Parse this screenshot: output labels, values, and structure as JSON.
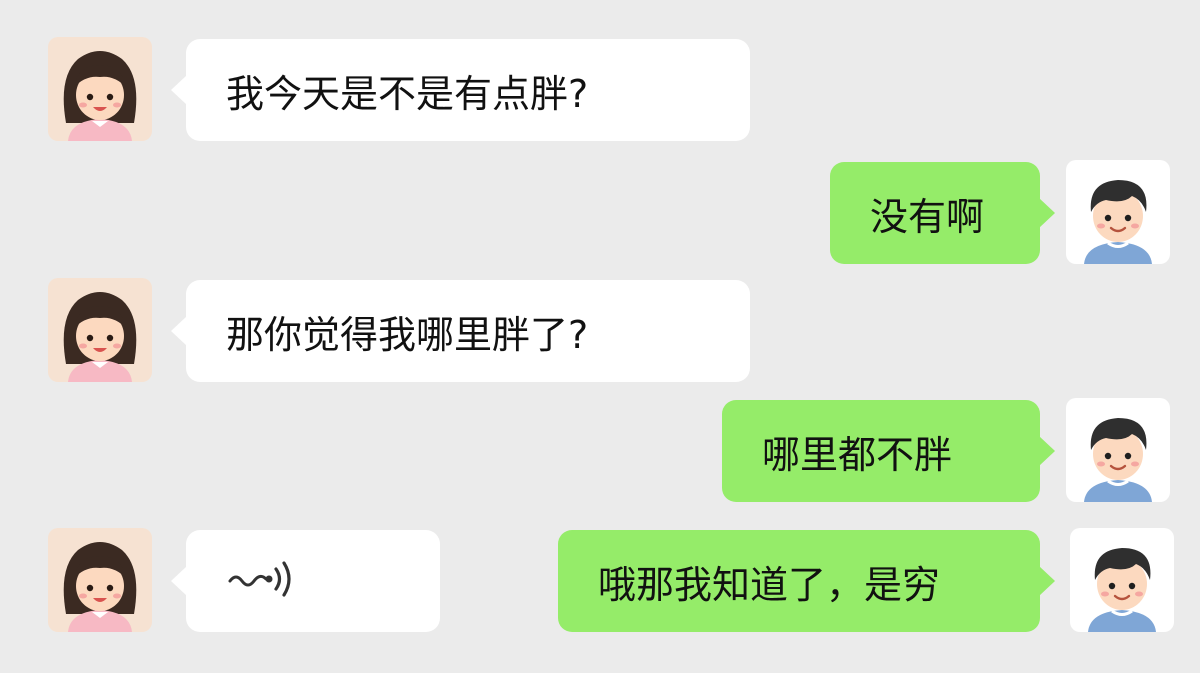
{
  "chat": {
    "messages": [
      {
        "sender": "girl",
        "type": "text",
        "text": "我今天是不是有点胖?"
      },
      {
        "sender": "boy",
        "type": "text",
        "text": "没有啊"
      },
      {
        "sender": "girl",
        "type": "text",
        "text": "那你觉得我哪里胖了?"
      },
      {
        "sender": "boy",
        "type": "text",
        "text": "哪里都不胖"
      },
      {
        "sender": "girl",
        "type": "voice",
        "icon": "voice-wave-icon"
      },
      {
        "sender": "boy",
        "type": "text",
        "text": "哦那我知道了，是穷"
      }
    ]
  },
  "colors": {
    "background": "#ebebeb",
    "left_bubble": "#ffffff",
    "right_bubble": "#95ec69"
  }
}
